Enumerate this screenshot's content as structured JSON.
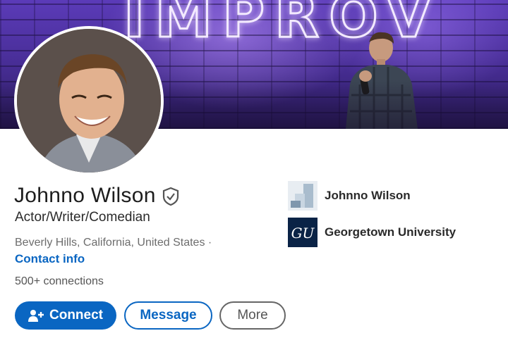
{
  "banner": {
    "sign_text": "IMPROV"
  },
  "profile": {
    "name": "Johnno Wilson",
    "headline": "Actor/Writer/Comedian",
    "location": "Beverly Hills, California, United States ·",
    "contact_info_label": "Contact info",
    "connections": "500+ connections",
    "verified_icon": "verified-shield-icon"
  },
  "actions": {
    "connect_label": "Connect",
    "message_label": "Message",
    "more_label": "More"
  },
  "organizations": [
    {
      "name": "Johnno Wilson",
      "logo": "company-logo"
    },
    {
      "name": "Georgetown University",
      "logo": "GU"
    }
  ],
  "colors": {
    "accent": "#0a66c2",
    "banner": "#4a2f9a",
    "text_muted": "#6d6d6d",
    "georgetown_navy": "#0a2346"
  }
}
